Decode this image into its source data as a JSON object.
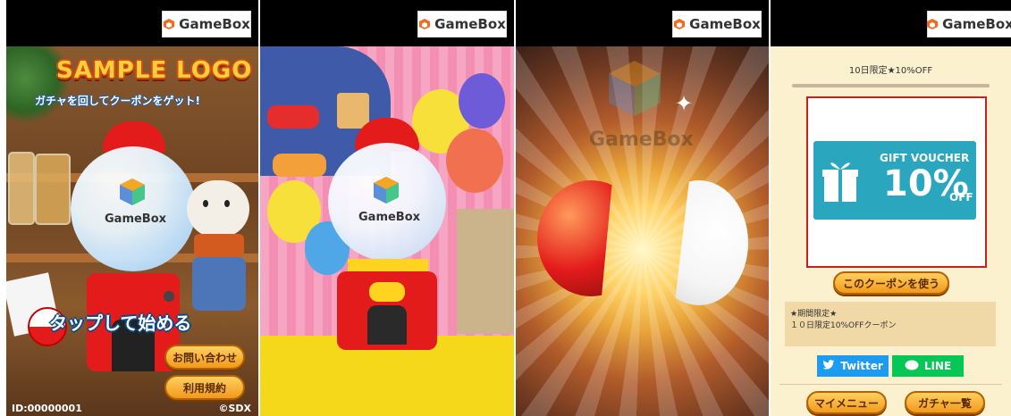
{
  "brand": "GameBox",
  "panel1": {
    "sample_logo": "SAMPLE LOGO",
    "subtitle": "ガチャを回してクーポンをゲット!",
    "machine_label": "GameBox",
    "tap_start": "タップして始める",
    "contact_button": "お問い合わせ",
    "terms_button": "利用規約",
    "user_id": "ID:00000001",
    "copyright": "©SDX"
  },
  "panel2": {
    "machine_label": "GameBox"
  },
  "panel3": {
    "machine_label": "GameBox"
  },
  "panel4": {
    "header": "10日限定★10%OFF",
    "voucher_title": "GIFT VOUCHER",
    "voucher_percent": "10%",
    "voucher_off": "OFF",
    "use_coupon_button": "このクーポンを使う",
    "desc_line1": "★期間限定★",
    "desc_line2": "１０日限定10%OFFクーポン",
    "twitter_label": "Twitter",
    "line_label": "LINE",
    "my_menu_button": "マイメニュー",
    "gacha_list_button": "ガチャ一覧"
  },
  "colors": {
    "accent_orange": "#f29a1b",
    "voucher_teal": "#2aa7bf",
    "twitter_blue": "#1d9bf0",
    "line_green": "#06c755"
  }
}
